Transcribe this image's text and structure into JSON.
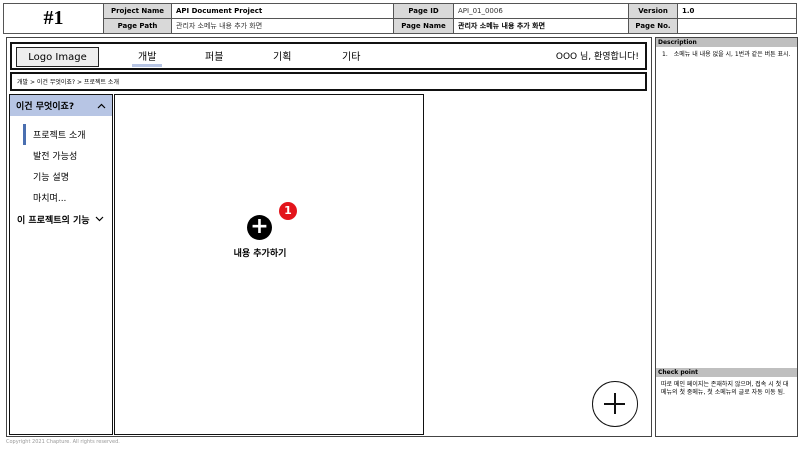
{
  "header": {
    "number": "#1",
    "project_name_label": "Project Name",
    "project_name": "API Document Project",
    "page_id_label": "Page ID",
    "page_id": "API_01_0006",
    "version_label": "Version",
    "version": "1.0",
    "page_path_label": "Page Path",
    "page_path": "관리자 소메뉴 내용 추가 화면",
    "page_name_label": "Page Name",
    "page_name": "관리자 소메뉴 내용 추가 화면",
    "page_no_label": "Page No.",
    "page_no": ""
  },
  "nav": {
    "logo": "Logo Image",
    "menus": [
      "개발",
      "퍼블",
      "기획",
      "기타"
    ],
    "welcome": "OOO 님, 환영합니다!"
  },
  "breadcrumb": "개발 > 이건 무엇이죠? > 프로젝트 소개",
  "sidebar": {
    "section_title": "이건 무엇이죠?",
    "items": [
      "프로젝트 소개",
      "발전 가능성",
      "기능 설명",
      "마치며..."
    ],
    "footer_title": "이 프로젝트의 기능"
  },
  "content": {
    "add_label": "내용 추가하기",
    "badge": "1"
  },
  "copyright": "Copyright 2021 Chapture.  All rights reserved.",
  "right_panel": {
    "description_title": "Description",
    "description_items": [
      {
        "num": "1.",
        "text": "소메뉴 내 내용 없을 시, 1번과 같은 버튼 표시."
      }
    ],
    "checkpoint_title": "Check point",
    "checkpoint_text": "따로 메인 페이지는 존재하지 않으며, 접속 시 첫 대메뉴의 첫 중메뉴, 첫 소메뉴의 글로 자동 이동 됨."
  },
  "colors": {
    "accent": "#b7c5e4",
    "active_bar": "#4a6fb0",
    "badge": "#e3141b",
    "header_label_bg": "#d9d9d9"
  }
}
